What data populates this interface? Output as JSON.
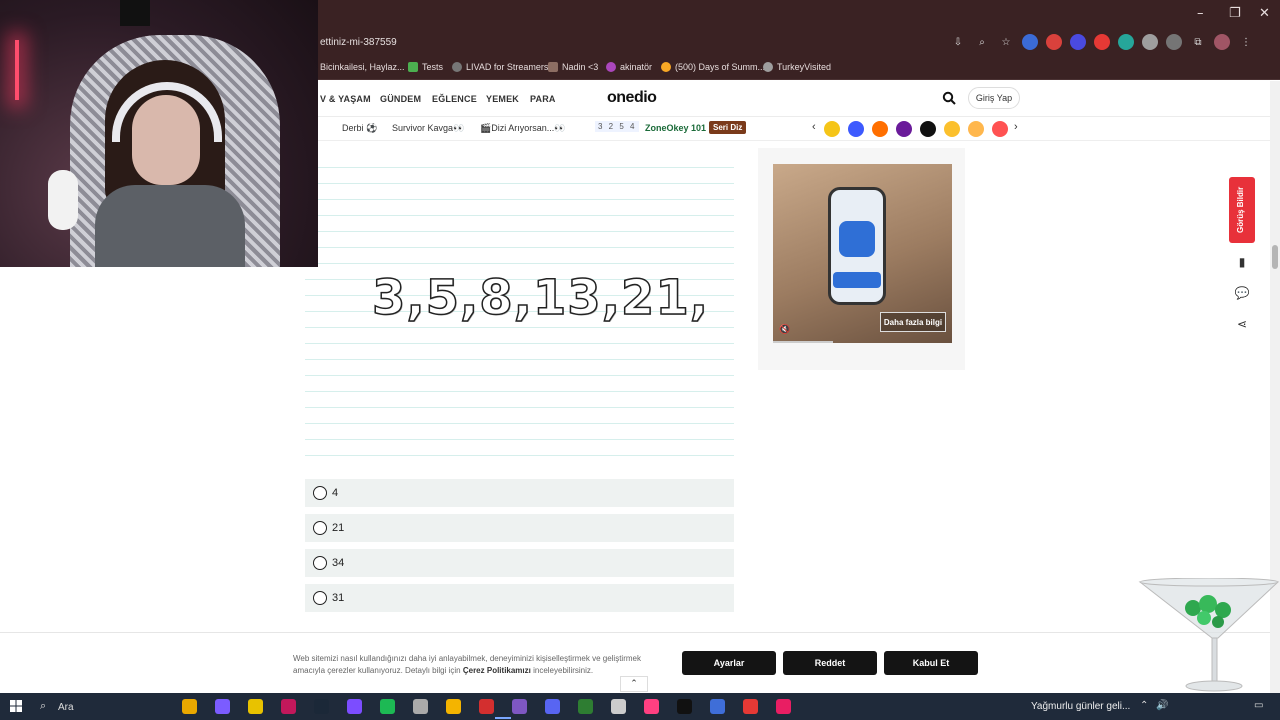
{
  "browser": {
    "url_fragment": "ettiniz-mi-387559",
    "window_controls": [
      "–",
      "❐",
      "✕"
    ],
    "bookmarks": [
      {
        "label": "Bicinkailesi, Haylaz...",
        "color": "#3a2223"
      },
      {
        "label": "Tests",
        "color": "#4caf50"
      },
      {
        "label": "LIVAD for Streamers",
        "color": "#777777"
      },
      {
        "label": "Nadin <3",
        "color": "#8d6e63"
      },
      {
        "label": "akinatör",
        "color": "#ab47bc"
      },
      {
        "label": "(500) Days of Summ...",
        "color": "#f9a825"
      },
      {
        "label": "TurkeyVisited",
        "color": "#9e9e9e"
      }
    ]
  },
  "site": {
    "logo": "onedio",
    "nav": [
      "V & YAŞAM",
      "GÜNDEM",
      "EĞLENCE",
      "YEMEK",
      "PARA"
    ],
    "login_label": "Giriş Yap",
    "subnav": [
      "Derbi ⚽",
      "Survivor Kavga👀",
      "🎬Dizi Arıyorsan...👀"
    ],
    "zone_badge": "3 2 5 4",
    "zoneokey": "ZoneOkey 101",
    "seri_diz": "Seri Diz"
  },
  "question": {
    "sequence": "3,5,8,13,21,",
    "options": [
      "4",
      "21",
      "34",
      "31"
    ]
  },
  "ad": {
    "more_info": "Daha fazla bilgi"
  },
  "sidebar": {
    "report": "Görüş Bildir"
  },
  "cookie": {
    "text_part1": "Web sitemizi nasıl kullandığınızı daha iyi anlayabilmek, deneyiminizi kişiselleştirmek ve geliştirmek amacıyla çerezler kullanıyoruz. Detaylı bilgi için ",
    "policy_link": "Çerez Politikamızı",
    "text_part2": " inceleyebilirsiniz.",
    "settings": "Ayarlar",
    "reject": "Reddet",
    "accept": "Kabul Et"
  },
  "taskbar": {
    "search_label": "Ara",
    "weather": "Yağmurlu günler geli...",
    "app_colors": [
      "#e9a800",
      "#7b5cff",
      "#e8c200",
      "#c2185b",
      "#1b2838",
      "#7c4dff",
      "#1db954",
      "#aaaaaa",
      "#f4b400",
      "#d32f2f",
      "#7e57c2",
      "#5865f2",
      "#2e7d32",
      "#cccccc",
      "#ff4081",
      "#111111",
      "#3f6ed8",
      "#e53935",
      "#e91e63"
    ]
  }
}
